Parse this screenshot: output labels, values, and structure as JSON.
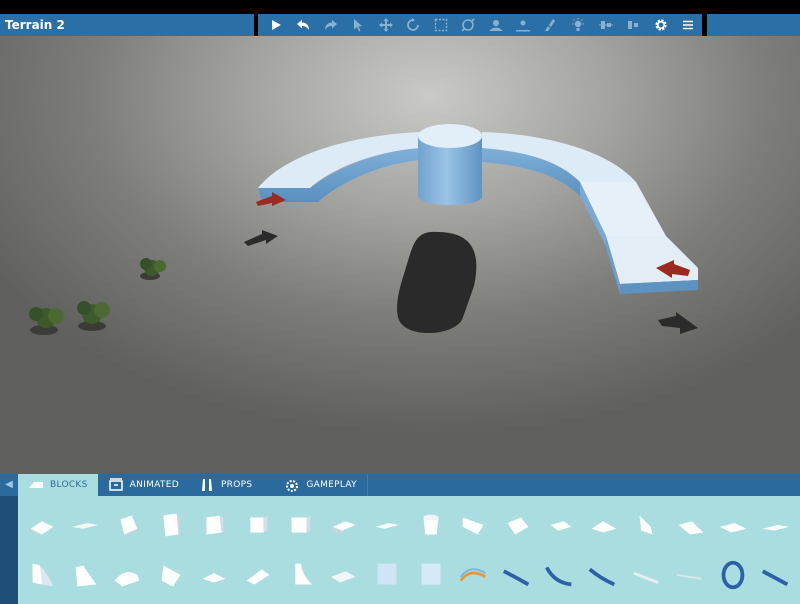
{
  "window": {
    "title": "Terrain 2"
  },
  "toolbar": {
    "buttons": [
      {
        "name": "play-icon",
        "dim": false
      },
      {
        "name": "undo-icon",
        "dim": false
      },
      {
        "name": "redo-icon",
        "dim": true
      },
      {
        "name": "select-cursor-icon",
        "dim": true
      },
      {
        "name": "move-icon",
        "dim": true
      },
      {
        "name": "rotate-icon",
        "dim": true
      },
      {
        "name": "scale-icon",
        "dim": true
      },
      {
        "name": "orbit-icon",
        "dim": true
      },
      {
        "name": "raise-terrain-icon",
        "dim": true
      },
      {
        "name": "lower-terrain-icon",
        "dim": true
      },
      {
        "name": "paint-icon",
        "dim": true
      },
      {
        "name": "light-icon",
        "dim": true
      },
      {
        "name": "align-icon",
        "dim": true
      },
      {
        "name": "distribute-icon",
        "dim": true
      },
      {
        "name": "settings-gear-icon",
        "dim": false
      },
      {
        "name": "menu-icon",
        "dim": false
      }
    ]
  },
  "panel": {
    "tabs": [
      {
        "label": "BLOCKS",
        "icon": "blocks-icon",
        "active": true
      },
      {
        "label": "ANIMATED",
        "icon": "animated-icon",
        "active": false
      },
      {
        "label": "PROPS",
        "icon": "props-icon",
        "active": false
      },
      {
        "label": "GAMEPLAY",
        "icon": "gameplay-icon",
        "active": false
      }
    ],
    "block_count": 36
  },
  "colors": {
    "accent": "#2a6fa6",
    "panel_bg": "#a9dde0",
    "track": "#b7d8ef",
    "boost": "#9c2a1e"
  }
}
